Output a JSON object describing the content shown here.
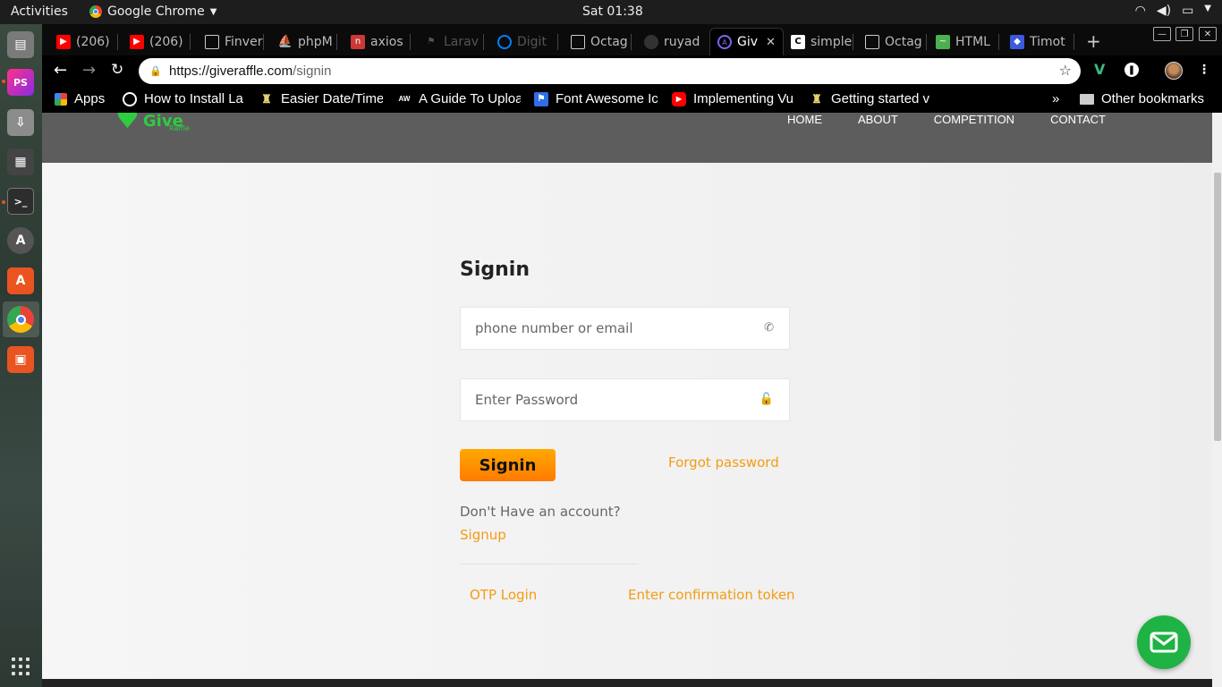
{
  "os": {
    "activities": "Activities",
    "app_name": "Google Chrome",
    "clock": "Sat 01:38"
  },
  "browser": {
    "tabs": [
      {
        "title": "(206)",
        "icon": "youtube-icon",
        "color": "#ff0000"
      },
      {
        "title": "(206)",
        "icon": "youtube-icon",
        "color": "#ff0000"
      },
      {
        "title": "Finver",
        "icon": "document-icon",
        "color": "#ffffff"
      },
      {
        "title": "phpM",
        "icon": "phpmyadmin-icon",
        "color": "#f89c0e"
      },
      {
        "title": "axios",
        "icon": "npm-icon",
        "color": "#cb3837"
      },
      {
        "title": "Larav",
        "icon": "laravel-icon",
        "color": "#555555"
      },
      {
        "title": "Digit",
        "icon": "digitalocean-icon",
        "color": "#0080ff"
      },
      {
        "title": "Octag",
        "icon": "document-icon",
        "color": "#ffffff"
      },
      {
        "title": "ruyad",
        "icon": "github-icon",
        "color": "#333333"
      },
      {
        "title": "Giv",
        "icon": "site-icon",
        "color": "#7b68ee"
      },
      {
        "title": "simple",
        "icon": "codepen-icon",
        "color": "#ffffff"
      },
      {
        "title": "Octag",
        "icon": "document-icon",
        "color": "#ffffff"
      },
      {
        "title": "HTML",
        "icon": "chart-icon",
        "color": "#4caf50"
      },
      {
        "title": "Timot",
        "icon": "shield-icon",
        "color": "#3b5bdb"
      }
    ],
    "active_tab_index": 9,
    "url_scheme_host": "https://giveraffle.com",
    "url_path": "/signin",
    "bookmarks": [
      {
        "label": "Apps",
        "icon": "apps-grid-icon"
      },
      {
        "label": "How to Install La",
        "icon": "bookmark-favicon"
      },
      {
        "label": "Easier Date/Time",
        "icon": "bookmark-favicon"
      },
      {
        "label": "A Guide To Uploa",
        "icon": "aw-favicon"
      },
      {
        "label": "Font Awesome Ic",
        "icon": "flag-favicon"
      },
      {
        "label": "Implementing Vu",
        "icon": "youtube-favicon"
      },
      {
        "label": "Getting started v",
        "icon": "bookmark-favicon"
      }
    ],
    "bookmarks_overflow": "»",
    "other_bookmarks": "Other bookmarks"
  },
  "site": {
    "logo_word": "Give",
    "logo_sub": "Raffle",
    "nav": [
      "HOME",
      "ABOUT",
      "COMPETITION",
      "CONTACT"
    ]
  },
  "signin": {
    "title": "Signin",
    "identity_placeholder": "phone number or email",
    "password_placeholder": "Enter Password",
    "submit_label": "Signin",
    "forgot_label": "Forgot password",
    "no_account_text": "Don't Have an account?",
    "signup_label": "Signup",
    "otp_label": "OTP Login",
    "confirm_token_label": "Enter confirmation token"
  },
  "colors": {
    "accent_orange": "#f39c12",
    "button_gradient_top": "#ffa800",
    "button_gradient_bottom": "#ff7b00",
    "brand_green": "#2ecc40",
    "fab_green": "#1fb244",
    "header_gray": "#5d5d5d"
  }
}
